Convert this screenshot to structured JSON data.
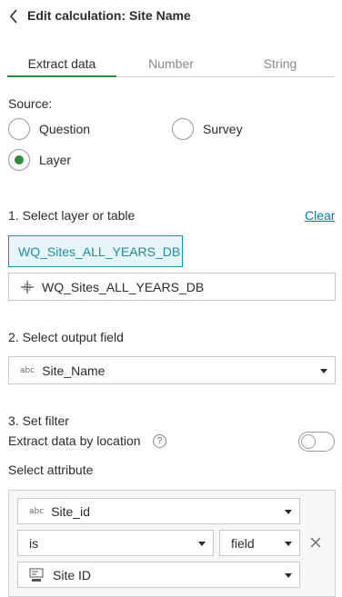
{
  "header": {
    "title": "Edit calculation: Site Name"
  },
  "tabs": [
    "Extract data",
    "Number",
    "String"
  ],
  "source": {
    "label": "Source:",
    "options": [
      "Question",
      "Survey",
      "Layer"
    ],
    "selected": "Layer"
  },
  "section1": {
    "heading": "1. Select layer or table",
    "clear_label": "Clear",
    "chip_label": "WQ_Sites_ALL_YEARS_DB",
    "layer_value": "WQ_Sites_ALL_YEARS_DB"
  },
  "section2": {
    "heading": "2. Select output field",
    "type_badge": "abc",
    "field_value": "Site_Name"
  },
  "section3": {
    "heading": "3. Set filter",
    "location_label": "Extract data by location",
    "location_enabled": false,
    "help_symbol": "?",
    "attribute_label": "Select attribute",
    "filter": {
      "attribute_type_badge": "abc",
      "attribute_value": "Site_id",
      "operator_value": "is",
      "compare_type_value": "field",
      "question_value": "Site ID"
    }
  },
  "colors": {
    "accent": "#2d8a3f",
    "chip": "#1a8fa3",
    "link": "#0079c1"
  }
}
